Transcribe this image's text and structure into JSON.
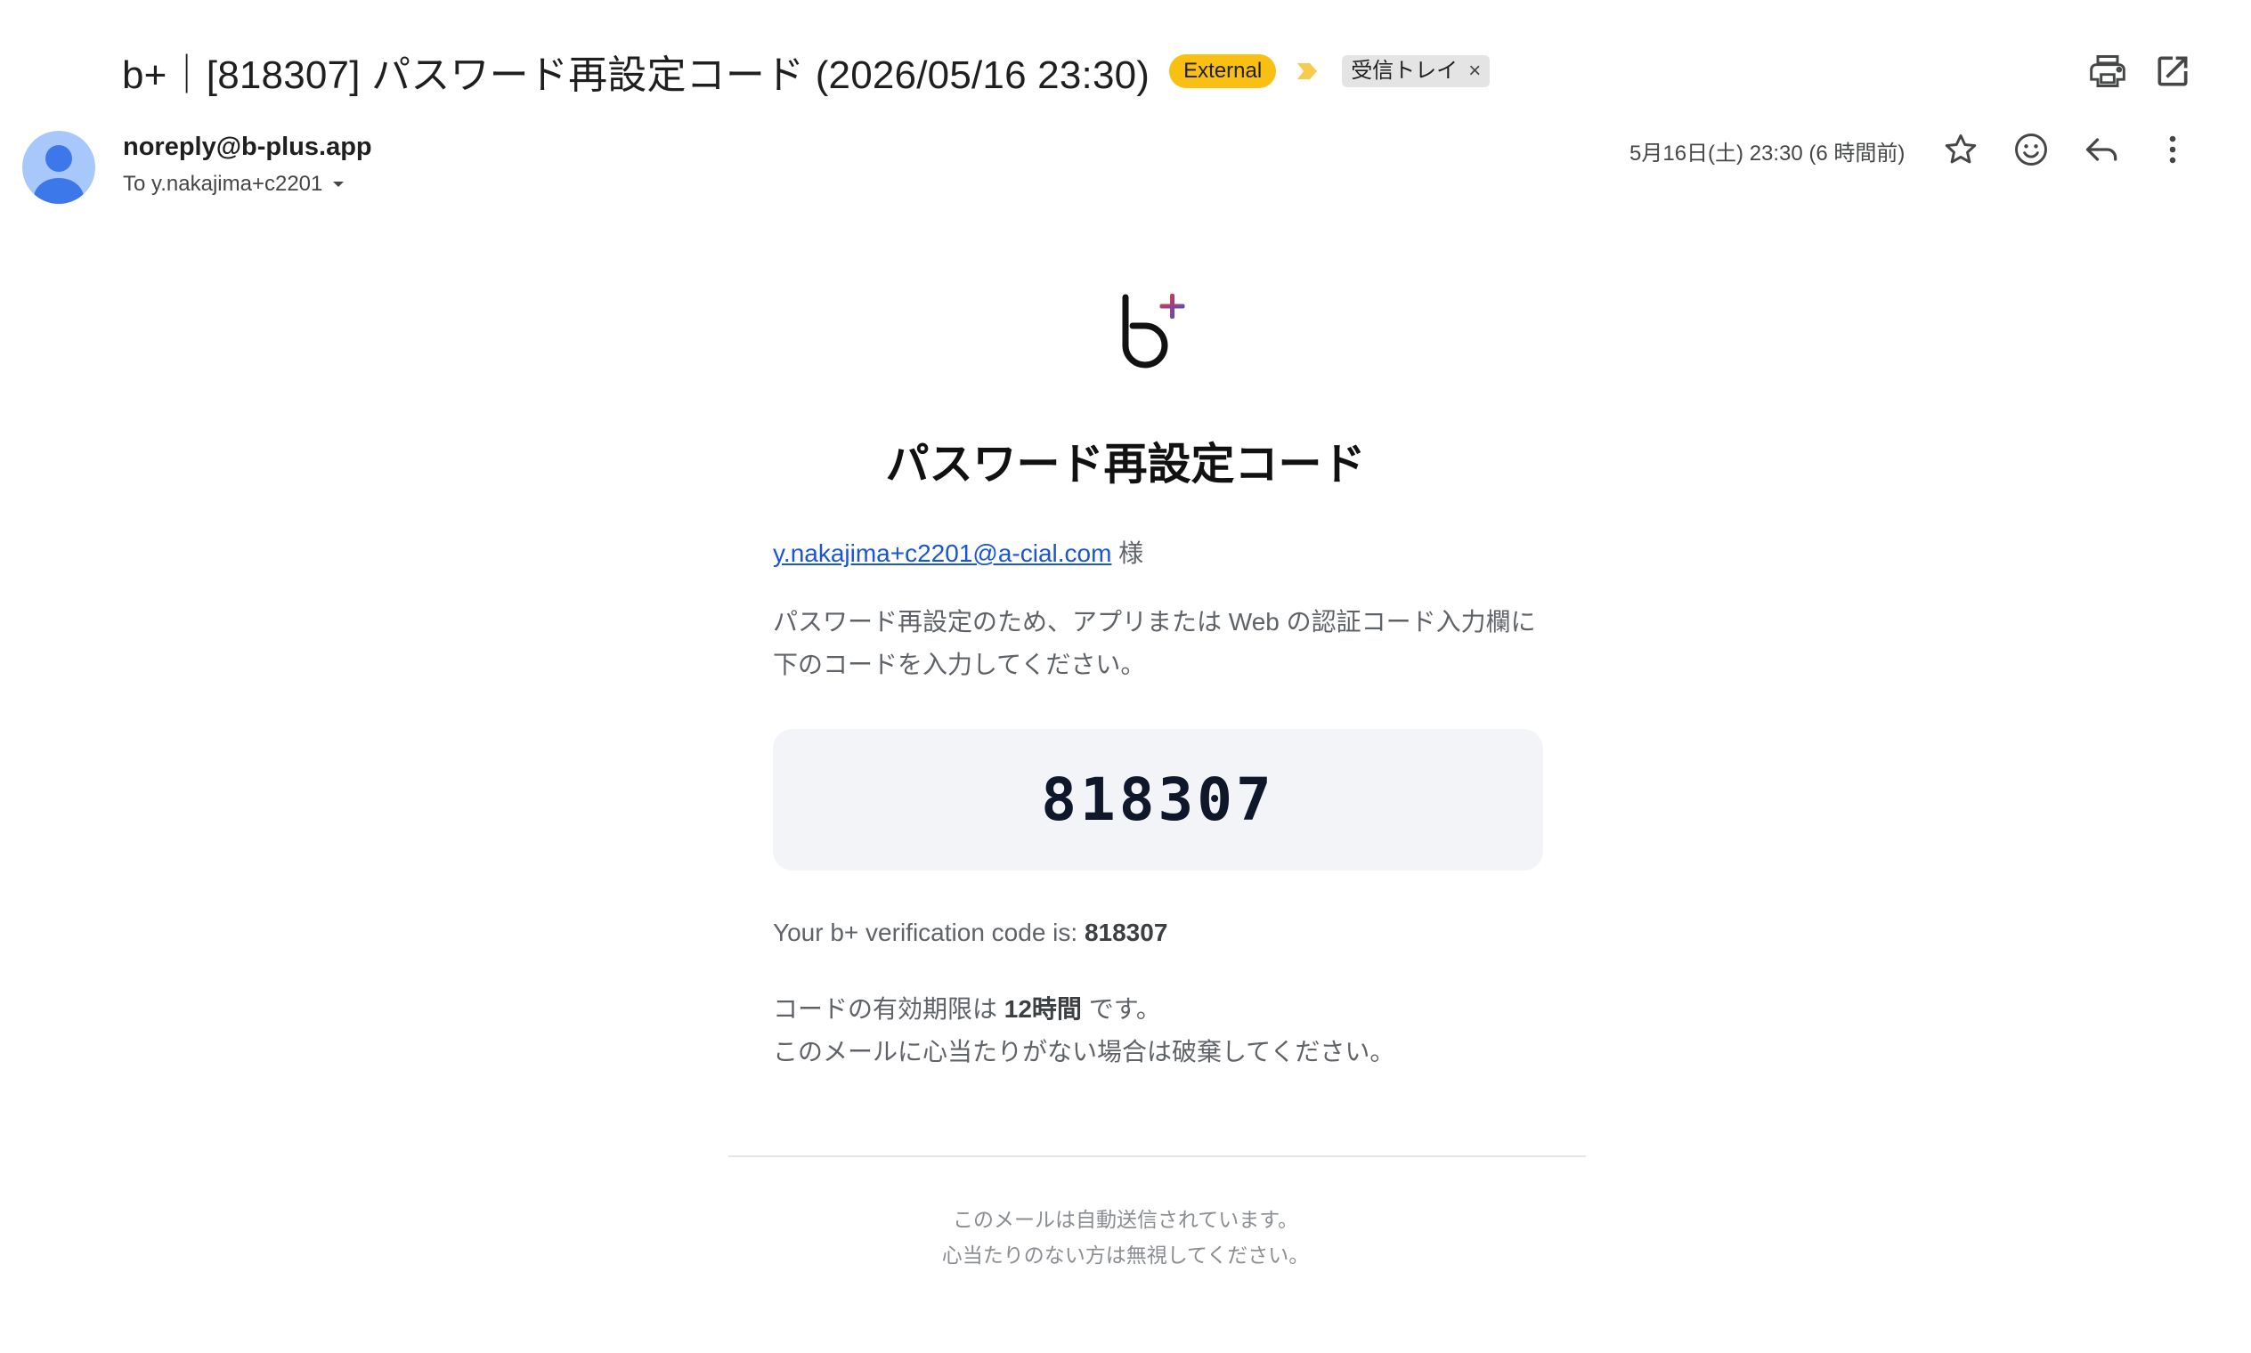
{
  "header": {
    "subject": "b+｜[818307] パスワード再設定コード (2026/05/16 23:30)",
    "external_badge": "External",
    "label": "受信トレイ",
    "label_close": "×"
  },
  "sender": {
    "name": "noreply@b-plus.app",
    "to": "To y.nakajima+c2201",
    "date": "5月16日(土) 23:30 (6 時間前)"
  },
  "email": {
    "title": "パスワード再設定コード",
    "greeting_email": "y.nakajima+c2201@a-cial.com",
    "greeting_suffix": " 様",
    "instruction_line1": "パスワード再設定のため、アプリまたは Web の認証コード入力欄に",
    "instruction_line2": "下のコードを入力してください。",
    "code": "818307",
    "verification_prefix": "Your b+ verification code is: ",
    "verification_code": "818307",
    "expiry_prefix": "コードの有効期限は ",
    "expiry_value": "12時間",
    "expiry_suffix": " です。",
    "discard_note": "このメールに心当たりがない場合は破棄してください。",
    "footer_line1": "このメールは自動送信されています。",
    "footer_line2": "心当たりのない方は無視してください。"
  },
  "colors": {
    "external_badge": "#f9bf12",
    "label_chip": "#e4e4e4",
    "link": "#1a55d3",
    "code_box": "#f3f4f7",
    "logo_plus_start": "#e53935",
    "logo_plus_end": "#3f51d8"
  },
  "icons": [
    "importance-marker-icon",
    "print-icon",
    "open-in-new-window-icon",
    "avatar-person-icon",
    "dropdown-arrow-icon",
    "star-icon",
    "emoji-icon",
    "reply-icon",
    "more-vert-icon",
    "b-plus-logo"
  ]
}
